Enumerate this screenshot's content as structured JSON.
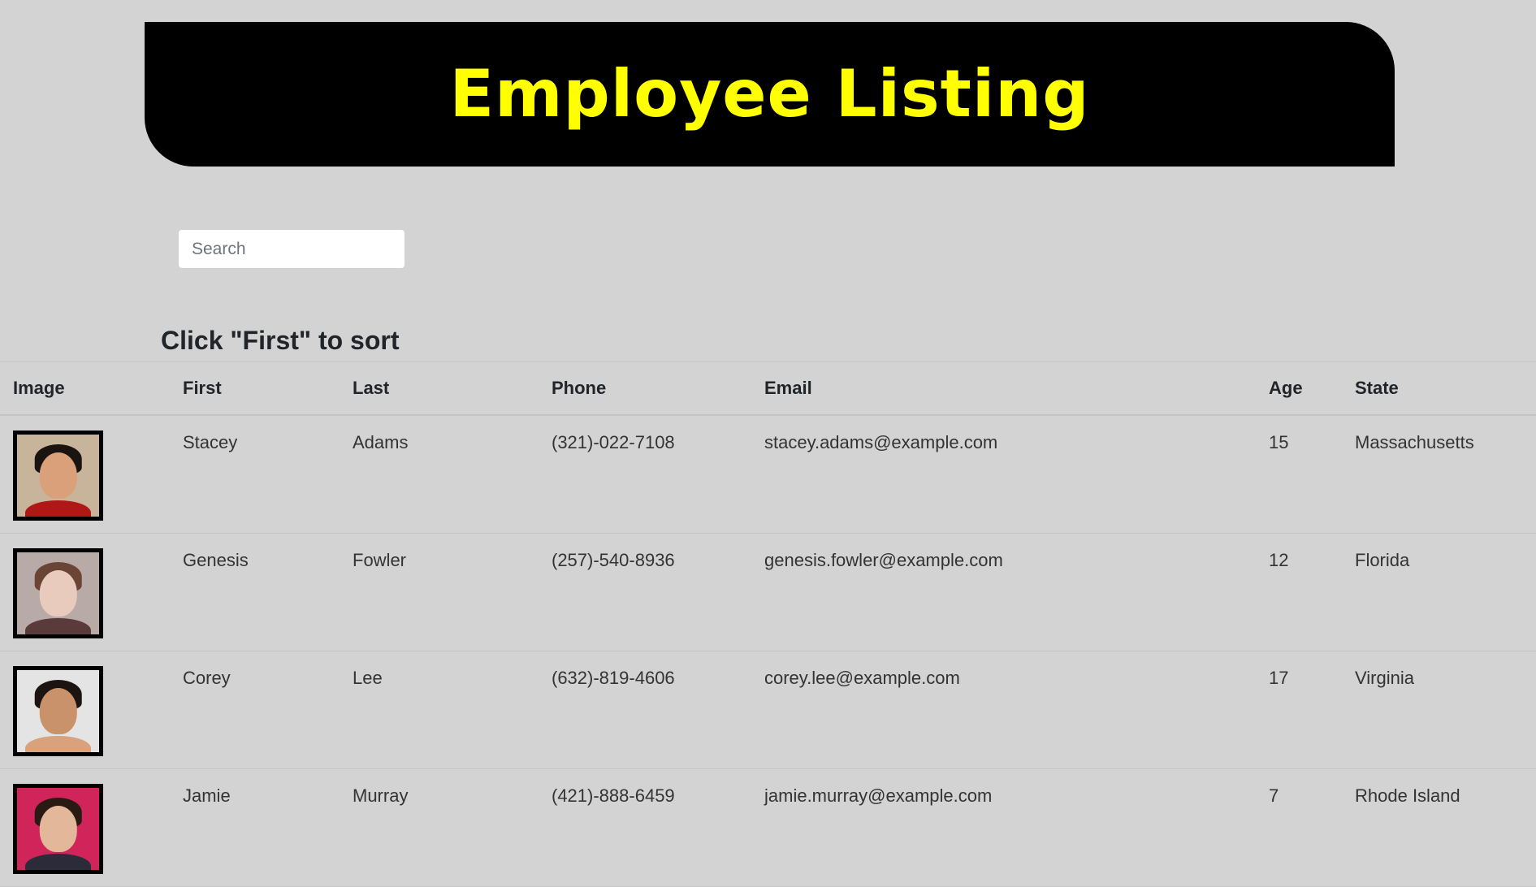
{
  "header": {
    "title": "Employee Listing"
  },
  "search": {
    "placeholder": "Search",
    "value": ""
  },
  "sort_hint": "Click \"First\" to sort",
  "table": {
    "columns": [
      "Image",
      "First",
      "Last",
      "Phone",
      "Email",
      "Age",
      "State"
    ],
    "rows": [
      {
        "first": "Stacey",
        "last": "Adams",
        "phone": "(321)-022-7108",
        "email": "stacey.adams@example.com",
        "age": "15",
        "state": "Massachusetts",
        "photo": {
          "bg": "#c8b49a",
          "skin": "#d9a07a",
          "hair": "#1a1410",
          "shirt": "#b01818"
        }
      },
      {
        "first": "Genesis",
        "last": "Fowler",
        "phone": "(257)-540-8936",
        "email": "genesis.fowler@example.com",
        "age": "12",
        "state": "Florida",
        "photo": {
          "bg": "#b8aaa6",
          "skin": "#e8cbbd",
          "hair": "#6a4434",
          "shirt": "#5a3a3a"
        }
      },
      {
        "first": "Corey",
        "last": "Lee",
        "phone": "(632)-819-4606",
        "email": "corey.lee@example.com",
        "age": "17",
        "state": "Virginia",
        "photo": {
          "bg": "#e4e4e4",
          "skin": "#c9926a",
          "hair": "#1c1410",
          "shirt": "#d8a27c"
        }
      },
      {
        "first": "Jamie",
        "last": "Murray",
        "phone": "(421)-888-6459",
        "email": "jamie.murray@example.com",
        "age": "7",
        "state": "Rhode Island",
        "photo": {
          "bg": "#d0245a",
          "skin": "#e3b79a",
          "hair": "#2a1a14",
          "shirt": "#2b2b3a"
        }
      }
    ]
  }
}
